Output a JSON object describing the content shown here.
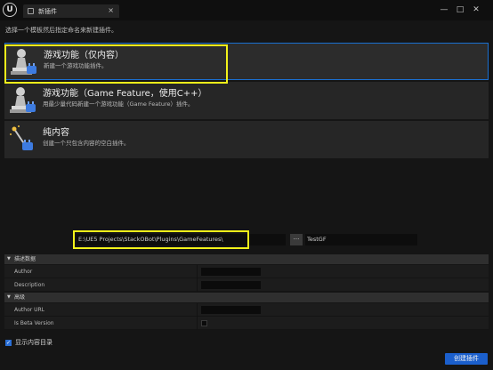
{
  "window": {
    "logo_letter": "U",
    "tab_label": "新插件",
    "tab_close": "×",
    "minimize": "—",
    "maximize": "□",
    "close": "✕"
  },
  "instruction": "选择一个模板然后指定命名来新建插件。",
  "templates": [
    {
      "title": "游戏功能（仅内容）",
      "description": "新建一个游戏功能插件。",
      "icon": "pawn-plugin-icon",
      "selected": true
    },
    {
      "title": "游戏功能（Game Feature，使用C++）",
      "description": "用最少量代码新建一个游戏功能（Game Feature）插件。",
      "icon": "pawn-plugin-icon",
      "selected": false
    },
    {
      "title": "纯内容",
      "description": "创建一个只包含内容的空白插件。",
      "icon": "magic-wand-icon",
      "selected": false
    }
  ],
  "path": {
    "value": "E:\\UE5 Projects\\StackOBot\\Plugins\\GameFeatures\\",
    "browse_label": "...",
    "plugin_name": "TestGF"
  },
  "details": {
    "sections": [
      {
        "label": "描述数据",
        "arrow": "▼",
        "rows": [
          {
            "label": "Author",
            "type": "text"
          },
          {
            "label": "Description",
            "type": "text"
          }
        ]
      },
      {
        "label": "高级",
        "arrow": "▼",
        "rows": [
          {
            "label": "Author URL",
            "type": "text"
          },
          {
            "label": "Is Beta Version",
            "type": "checkbox"
          }
        ]
      }
    ]
  },
  "footer": {
    "show_content_label": "显示内容目录",
    "show_content_check": "✓",
    "create_label": "创建插件"
  },
  "colors": {
    "accent_blue": "#1b5fcc",
    "highlight_yellow": "#f2f21a",
    "background": "#151515"
  }
}
